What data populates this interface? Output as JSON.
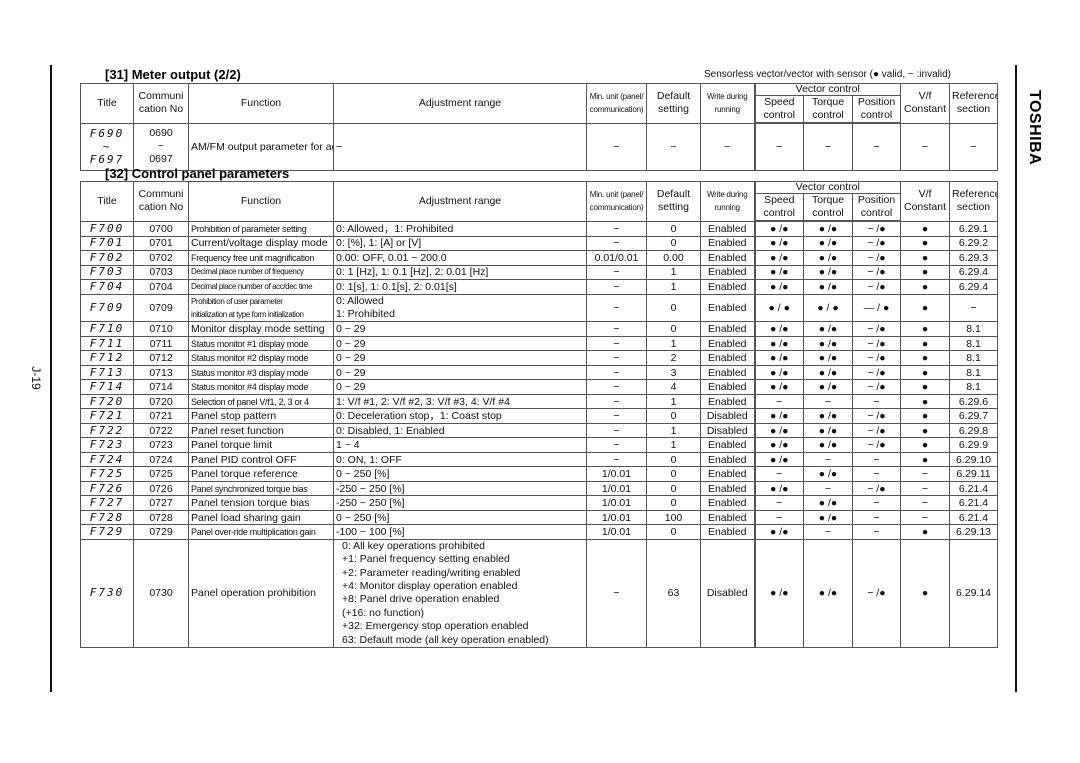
{
  "page": {
    "page_number": "J-19",
    "brand": "TOSHIBA",
    "legend": "Sensorless vector/vector with sensor (● valid, − :invalid)"
  },
  "headers": {
    "title": "Title",
    "comm": [
      "Communi",
      "cation No"
    ],
    "function": "Function",
    "adjustment": "Adjustment range",
    "min_unit": [
      "Min. unit (panel/",
      "communication)"
    ],
    "default": [
      "Default",
      "setting"
    ],
    "write": [
      "Write during",
      "running"
    ],
    "vector_control": "Vector control",
    "speed": [
      "Speed",
      "control"
    ],
    "torque": [
      "Torque",
      "control"
    ],
    "position": [
      "Position",
      "control"
    ],
    "vf": [
      "V/f",
      "Constant"
    ],
    "reference": [
      "Reference",
      "section"
    ]
  },
  "section31": {
    "title": "[31] Meter output (2/2)",
    "row": {
      "title_from": "F690",
      "title_sep": "~",
      "title_to": "F697",
      "comm_from": "0690",
      "comm_sep": "~",
      "comm_to": "0697",
      "function": "AM/FM output parameter for adjustment",
      "adjustment": "−",
      "min_unit": "−",
      "default": "−",
      "write": "−",
      "speed": "−",
      "torque": "−",
      "position": "−",
      "vf": "−",
      "reference": "−"
    }
  },
  "section32": {
    "title": "[32] Control panel parameters",
    "rows": [
      {
        "title": "F700",
        "comm": "0700",
        "function": "Prohibition of parameter setting",
        "adjustment": "0: Allowed，1: Prohibited",
        "min_unit": "−",
        "default": "0",
        "write": "Enabled",
        "speed": "● /●",
        "torque": "● /●",
        "position": "− /●",
        "vf": "●",
        "reference": "6.29.1"
      },
      {
        "title": "F701",
        "comm": "0701",
        "function": "Current/voltage display mode",
        "adjustment": "0: [%], 1: [A] or [V]",
        "min_unit": "−",
        "default": "0",
        "write": "Enabled",
        "speed": "● /●",
        "torque": "● /●",
        "position": "− /●",
        "vf": "●",
        "reference": "6.29.2"
      },
      {
        "title": "F702",
        "comm": "0702",
        "function": "Frequency free unit magnification",
        "adjustment": "0.00: OFF, 0.01 ~ 200.0",
        "min_unit": "0.01/0.01",
        "default": "0.00",
        "write": "Enabled",
        "speed": "● /●",
        "torque": "● /●",
        "position": "− /●",
        "vf": "●",
        "reference": "6.29.3"
      },
      {
        "title": "F703",
        "comm": "0703",
        "function": "Decimal place number of frequency",
        "adjustment": "0: 1 [Hz], 1: 0.1 [Hz], 2: 0.01 [Hz]",
        "min_unit": "−",
        "default": "1",
        "write": "Enabled",
        "speed": "● /●",
        "torque": "● /●",
        "position": "− /●",
        "vf": "●",
        "reference": "6.29.4"
      },
      {
        "title": "F704",
        "comm": "0704",
        "function": "Decimal place number of acc/dec time",
        "adjustment": "0: 1[s], 1: 0.1[s], 2: 0.01[s]",
        "min_unit": "−",
        "default": "1",
        "write": "Enabled",
        "speed": "● /●",
        "torque": "● /●",
        "position": "− /●",
        "vf": "●",
        "reference": "6.29.4"
      },
      {
        "title": "F709",
        "comm": "0709",
        "function": [
          "Prohibition of user parameter",
          "initialization at type form initialization"
        ],
        "adjustment": [
          "0: Allowed",
          "1: Prohibited"
        ],
        "min_unit": "−",
        "default": "0",
        "write": "Enabled",
        "speed": "● / ●",
        "torque": "● / ●",
        "position": "— / ●",
        "vf": "●",
        "reference": "−"
      },
      {
        "title": "F710",
        "comm": "0710",
        "function": "Monitor display mode setting",
        "adjustment": "0 ~ 29",
        "min_unit": "−",
        "default": "0",
        "write": "Enabled",
        "speed": "● /●",
        "torque": "● /●",
        "position": "− /●",
        "vf": "●",
        "reference": "8.1"
      },
      {
        "title": "F711",
        "comm": "0711",
        "function": "Status monitor #1 display mode",
        "adjustment": "0 ~ 29",
        "min_unit": "−",
        "default": "1",
        "write": "Enabled",
        "speed": "● /●",
        "torque": "● /●",
        "position": "− /●",
        "vf": "●",
        "reference": "8.1"
      },
      {
        "title": "F712",
        "comm": "0712",
        "function": "Status monitor #2 display mode",
        "adjustment": "0 ~ 29",
        "min_unit": "−",
        "default": "2",
        "write": "Enabled",
        "speed": "● /●",
        "torque": "● /●",
        "position": "− /●",
        "vf": "●",
        "reference": "8.1"
      },
      {
        "title": "F713",
        "comm": "0713",
        "function": "Status monitor #3 display mode",
        "adjustment": "0 ~ 29",
        "min_unit": "−",
        "default": "3",
        "write": "Enabled",
        "speed": "● /●",
        "torque": "● /●",
        "position": "− /●",
        "vf": "●",
        "reference": "8.1"
      },
      {
        "title": "F714",
        "comm": "0714",
        "function": "Status monitor #4 display mode",
        "adjustment": "0 ~ 29",
        "min_unit": "−",
        "default": "4",
        "write": "Enabled",
        "speed": "● /●",
        "torque": "● /●",
        "position": "− /●",
        "vf": "●",
        "reference": "8.1"
      },
      {
        "title": "F720",
        "comm": "0720",
        "function": "Selection of panel V/f1, 2, 3 or 4",
        "adjustment": "1: V/f #1, 2: V/f #2, 3: V/f #3, 4: V/f #4",
        "min_unit": "−",
        "default": "1",
        "write": "Enabled",
        "speed": "−",
        "torque": "−",
        "position": "−",
        "vf": "●",
        "reference": "6.29.6"
      },
      {
        "title": "F721",
        "comm": "0721",
        "function": "Panel stop pattern",
        "adjustment": "0: Deceleration stop，1: Coast stop",
        "min_unit": "−",
        "default": "0",
        "write": "Disabled",
        "speed": "● /●",
        "torque": "● /●",
        "position": "− /●",
        "vf": "●",
        "reference": "6.29.7"
      },
      {
        "title": "F722",
        "comm": "0722",
        "function": "Panel reset function",
        "adjustment": "0: Disabled, 1: Enabled",
        "min_unit": "−",
        "default": "1",
        "write": "Disabled",
        "speed": "● /●",
        "torque": "● /●",
        "position": "− /●",
        "vf": "●",
        "reference": "6.29.8"
      },
      {
        "title": "F723",
        "comm": "0723",
        "function": "Panel torque limit",
        "adjustment": "1 ~ 4",
        "min_unit": "−",
        "default": "1",
        "write": "Enabled",
        "speed": "● /●",
        "torque": "● /●",
        "position": "− /●",
        "vf": "●",
        "reference": "6.29.9"
      },
      {
        "title": "F724",
        "comm": "0724",
        "function": "Panel PID control OFF",
        "adjustment": "0: ON, 1: OFF",
        "min_unit": "−",
        "default": "0",
        "write": "Enabled",
        "speed": "● /●",
        "torque": "−",
        "position": "−",
        "vf": "●",
        "reference": "6.29.10"
      },
      {
        "title": "F725",
        "comm": "0725",
        "function": "Panel torque reference",
        "adjustment": "0 ~ 250 [%]",
        "min_unit": "1/0.01",
        "default": "0",
        "write": "Enabled",
        "speed": "−",
        "torque": "● /●",
        "position": "−",
        "vf": "−",
        "reference": "6.29.11"
      },
      {
        "title": "F726",
        "comm": "0726",
        "function": "Panel synchronized torque bias",
        "adjustment": "-250 ~ 250 [%]",
        "min_unit": "1/0.01",
        "default": "0",
        "write": "Enabled",
        "speed": "● /●",
        "torque": "−",
        "position": "− /●",
        "vf": "−",
        "reference": "6.21.4"
      },
      {
        "title": "F727",
        "comm": "0727",
        "function": "Panel tension torque bias",
        "adjustment": "-250 ~ 250 [%]",
        "min_unit": "1/0.01",
        "default": "0",
        "write": "Enabled",
        "speed": "−",
        "torque": "● /●",
        "position": "−",
        "vf": "−",
        "reference": "6.21.4"
      },
      {
        "title": "F728",
        "comm": "0728",
        "function": "Panel load sharing gain",
        "adjustment": "0 ~ 250 [%]",
        "min_unit": "1/0.01",
        "default": "100",
        "write": "Enabled",
        "speed": "−",
        "torque": "● /●",
        "position": "−",
        "vf": "−",
        "reference": "6.21.4"
      },
      {
        "title": "F729",
        "comm": "0729",
        "function": "Panel over-ride multiplication gain",
        "adjustment": "-100 ~ 100 [%]",
        "min_unit": "1/0.01",
        "default": "0",
        "write": "Enabled",
        "speed": "● /●",
        "torque": "−",
        "position": "−",
        "vf": "●",
        "reference": "6.29.13"
      },
      {
        "title": "F730",
        "comm": "0730",
        "function": "Panel operation prohibition",
        "adjustment": [
          "0: All key operations prohibited",
          "+1: Panel frequency setting enabled",
          "+2: Parameter reading/writing enabled",
          "+4: Monitor display operation enabled",
          "+8: Panel drive operation enabled",
          "(+16: no function)",
          "+32: Emergency stop operation enabled",
          "63: Default mode (all key operation enabled)"
        ],
        "min_unit": "−",
        "default": "63",
        "write": "Disabled",
        "speed": "● /●",
        "torque": "● /●",
        "position": "− /●",
        "vf": "●",
        "reference": "6.29.14"
      }
    ]
  }
}
